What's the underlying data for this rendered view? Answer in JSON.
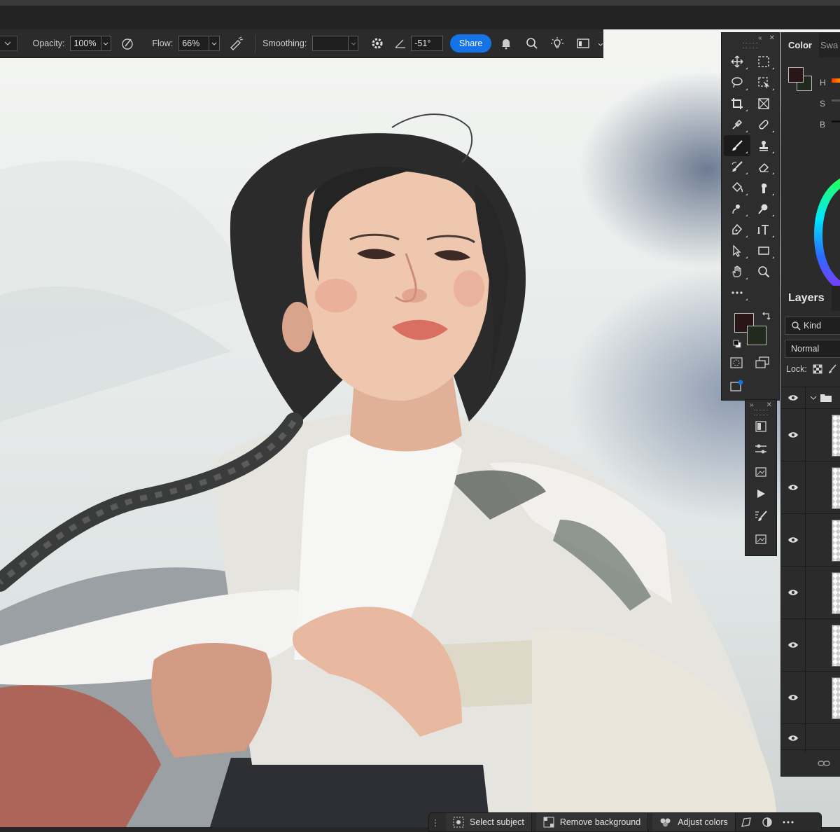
{
  "options": {
    "opacity_label": "Opacity:",
    "opacity_value": "100%",
    "flow_label": "Flow:",
    "flow_value": "66%",
    "smoothing_label": "Smoothing:",
    "smoothing_value": "",
    "angle_value": "-51°",
    "share_label": "Share"
  },
  "color_panel": {
    "tabs": [
      "Color",
      "Swa"
    ],
    "h_label": "H",
    "s_label": "S",
    "b_label": "B",
    "foreground": "#2a1517",
    "background": "#222a1e"
  },
  "layers_panel": {
    "tab_label": "Layers",
    "kind_label": "Kind",
    "blend_mode": "Normal",
    "lock_label": "Lock:"
  },
  "task_bar": {
    "select_subject": "Select subject",
    "remove_background": "Remove background",
    "adjust_colors": "Adjust colors"
  },
  "colors": {
    "accent": "#1473e6",
    "panel": "#2d2d2d"
  }
}
